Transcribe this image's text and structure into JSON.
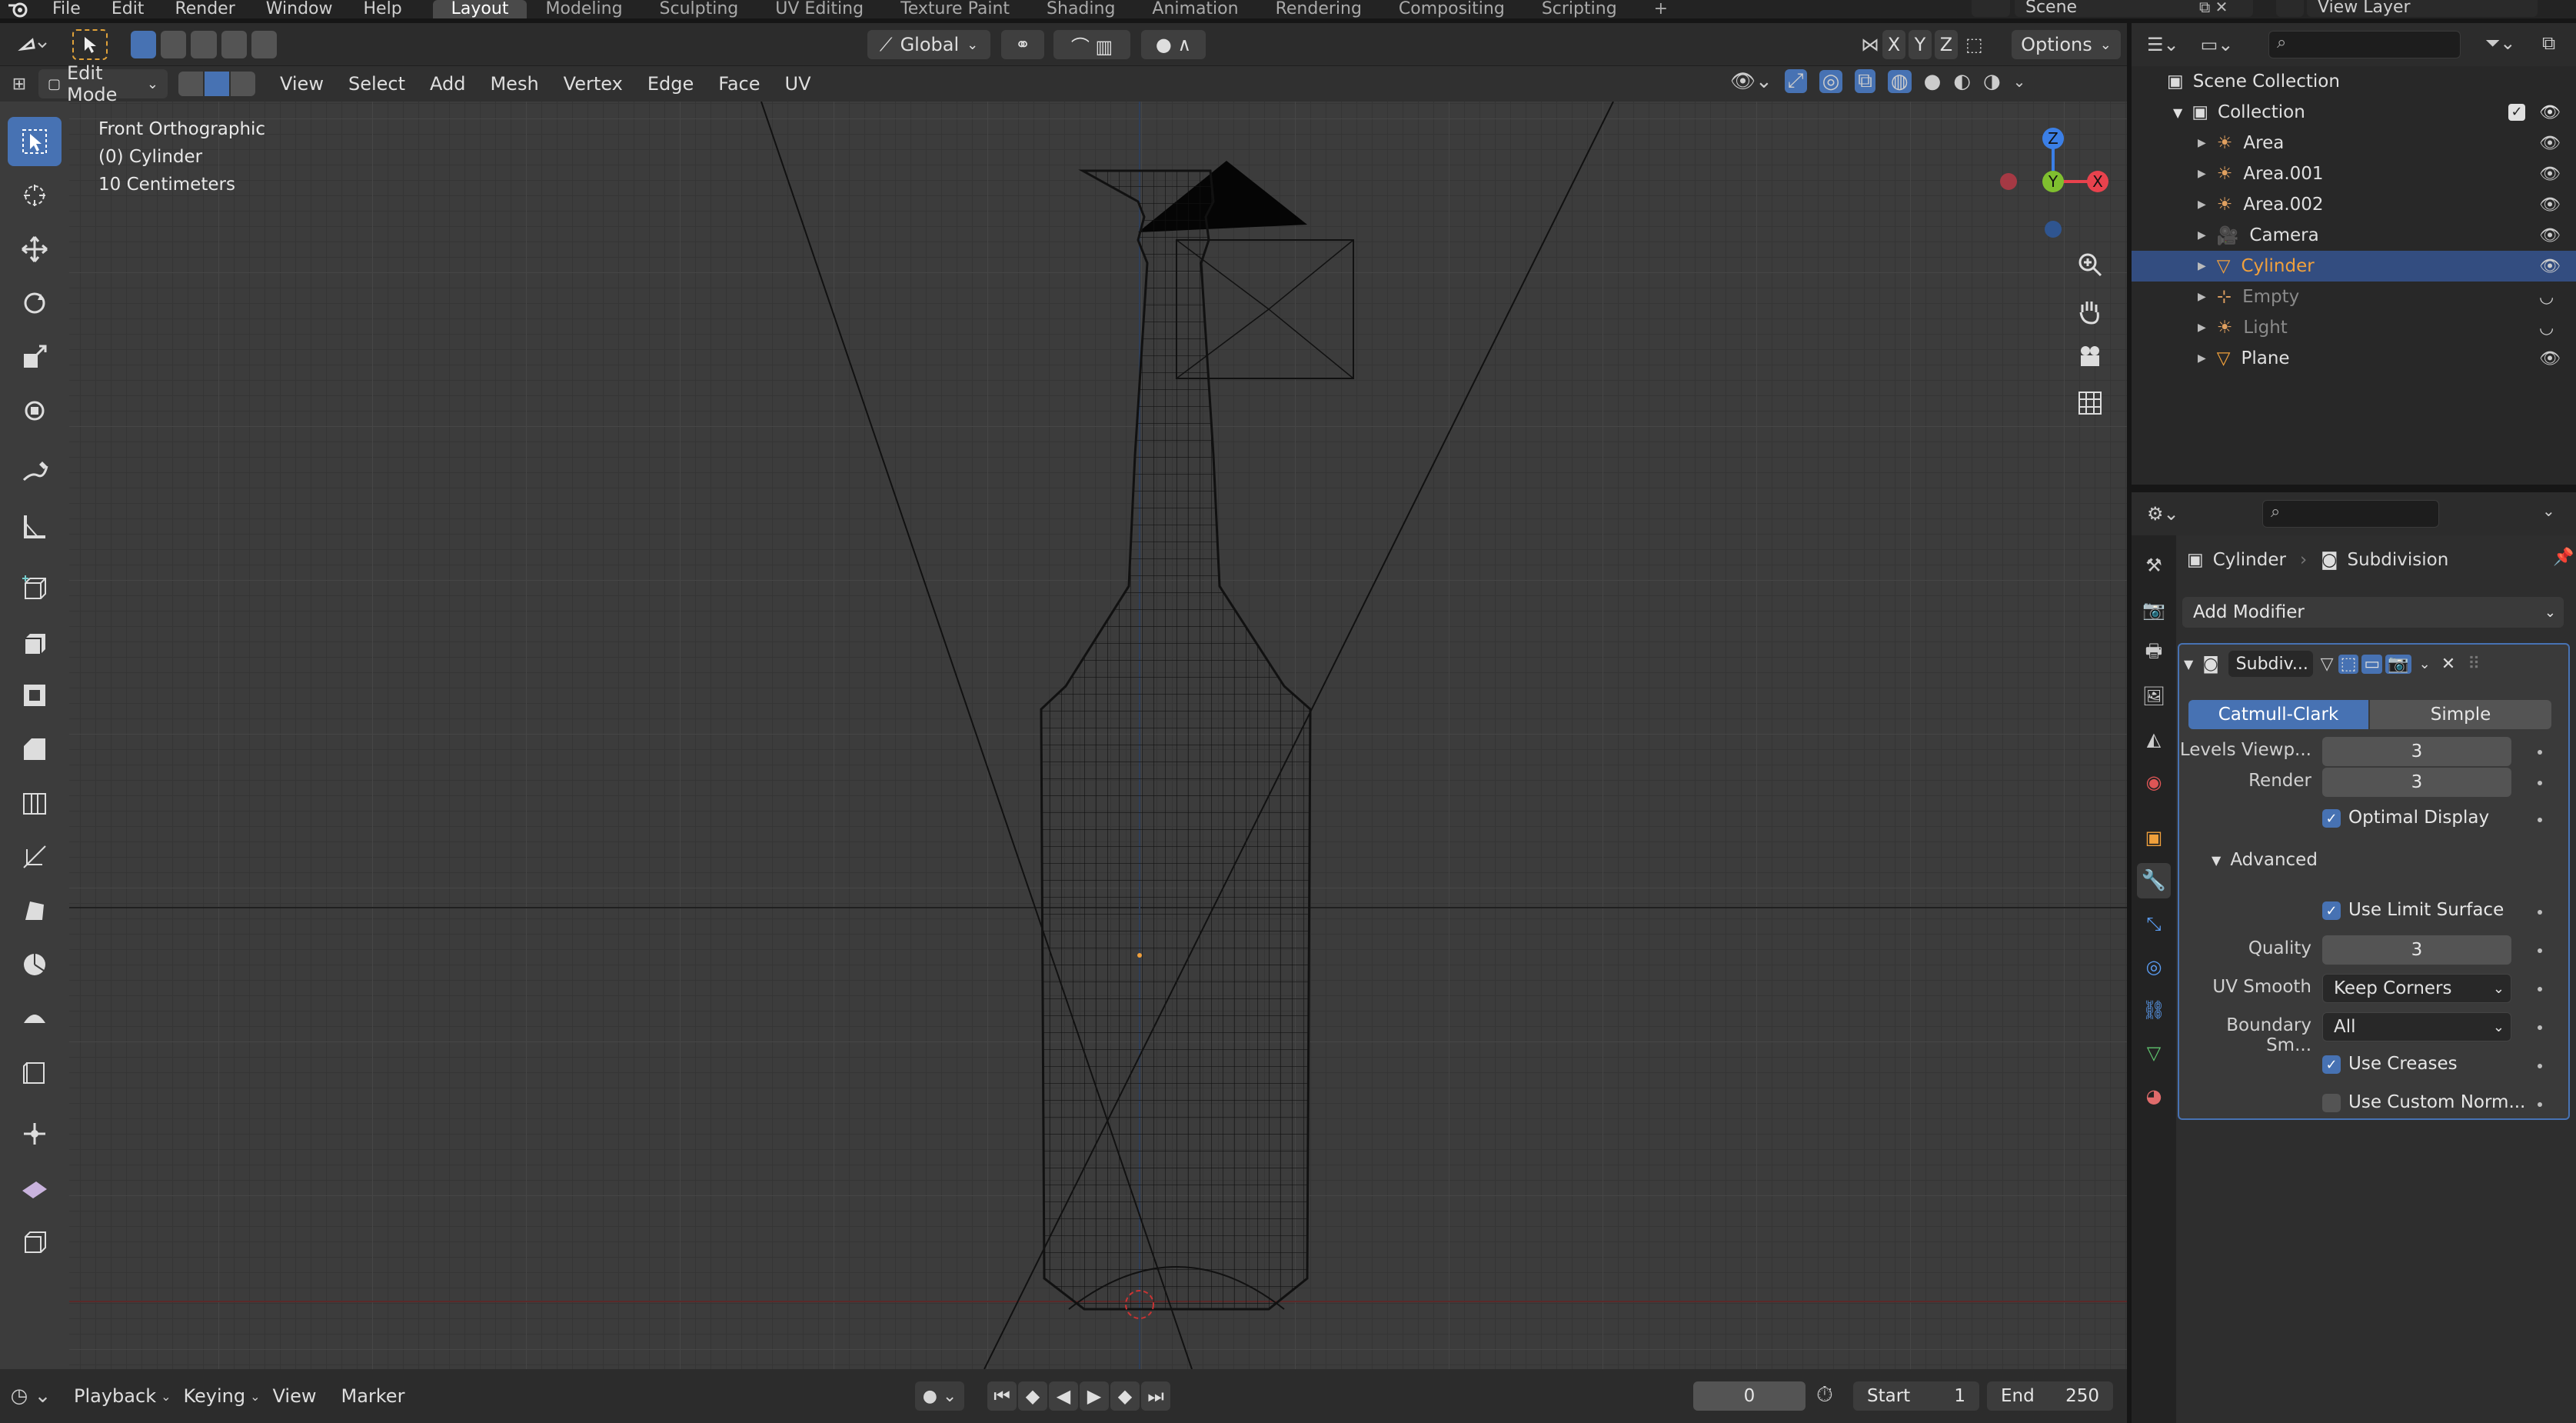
{
  "menubar": {
    "items": [
      "File",
      "Edit",
      "Render",
      "Window",
      "Help"
    ],
    "workspaces": [
      "Layout",
      "Modeling",
      "Sculpting",
      "UV Editing",
      "Texture Paint",
      "Shading",
      "Animation",
      "Rendering",
      "Compositing",
      "Scripting"
    ],
    "active_workspace": "Layout",
    "scene": "Scene",
    "view_layer": "View Layer"
  },
  "viewport_header": {
    "transform_orientation": "Global",
    "options_label": "Options",
    "axes": [
      "X",
      "Y",
      "Z"
    ],
    "mode": "Edit Mode",
    "menus": [
      "View",
      "Select",
      "Add",
      "Mesh",
      "Vertex",
      "Edge",
      "Face",
      "UV"
    ]
  },
  "viewport_info": {
    "view_name": "Front Orthographic",
    "object_name": "(0) Cylinder",
    "grid_scale": "10 Centimeters"
  },
  "gizmo": {
    "z_label": "Z",
    "y_label": "Y",
    "x_label": "X"
  },
  "timeline": {
    "menus": [
      "Playback",
      "Keying",
      "View",
      "Marker"
    ],
    "current_frame": "0",
    "start_label": "Start",
    "start_value": "1",
    "end_label": "End",
    "end_value": "250"
  },
  "outliner": {
    "root": "Scene Collection",
    "collection": "Collection",
    "items": [
      {
        "name": "Area",
        "icon": "light-icon",
        "dim": false
      },
      {
        "name": "Area.001",
        "icon": "light-icon",
        "dim": false
      },
      {
        "name": "Area.002",
        "icon": "light-icon",
        "dim": false
      },
      {
        "name": "Camera",
        "icon": "camera-icon",
        "dim": false
      },
      {
        "name": "Cylinder",
        "icon": "mesh-icon",
        "dim": false,
        "selected": true
      },
      {
        "name": "Empty",
        "icon": "empty-icon",
        "dim": true
      },
      {
        "name": "Light",
        "icon": "light-icon",
        "dim": true
      },
      {
        "name": "Plane",
        "icon": "mesh-icon",
        "dim": false
      }
    ]
  },
  "properties": {
    "breadcrumb_object": "Cylinder",
    "breadcrumb_modifier": "Subdivision",
    "add_modifier": "Add Modifier",
    "modifier_name": "Subdiv...",
    "algorithm_options": [
      "Catmull-Clark",
      "Simple"
    ],
    "algorithm_selected": "Catmull-Clark",
    "levels_viewport_label": "Levels Viewp...",
    "levels_viewport_value": "3",
    "render_label": "Render",
    "render_value": "3",
    "optimal_display_label": "Optimal Display",
    "optimal_display": true,
    "advanced_label": "Advanced",
    "use_limit_surface_label": "Use Limit Surface",
    "use_limit_surface": true,
    "quality_label": "Quality",
    "quality_value": "3",
    "uv_smooth_label": "UV Smooth",
    "uv_smooth_value": "Keep Corners",
    "boundary_smooth_label": "Boundary Sm...",
    "boundary_smooth_value": "All",
    "use_creases_label": "Use Creases",
    "use_creases": true,
    "use_custom_normals_label": "Use Custom Norm...",
    "use_custom_normals": false
  },
  "colors": {
    "accent": "#4772b3",
    "selected_row": "#334d80",
    "active_object_text": "#f0a03c",
    "x_axis": "#e8424d",
    "y_axis": "#7fbf2f",
    "z_axis": "#3b7fe6"
  }
}
